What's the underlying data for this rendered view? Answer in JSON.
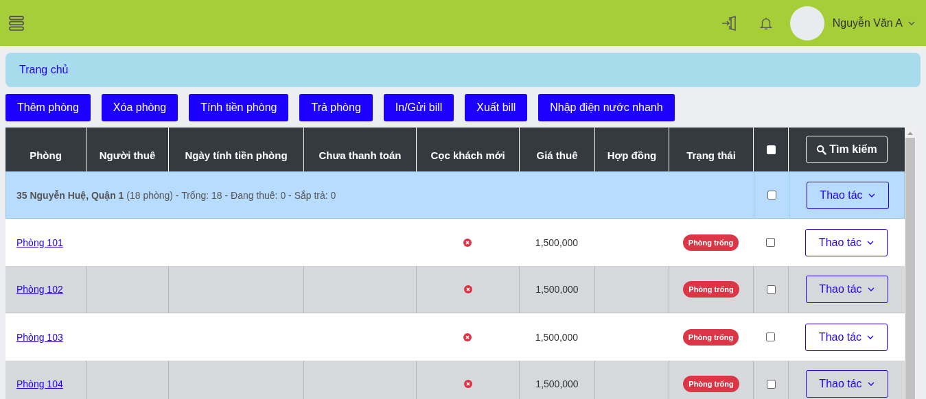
{
  "topbar": {
    "user_name": "Nguyễn Văn A"
  },
  "breadcrumb": "Trang chủ",
  "actions": [
    "Thêm phòng",
    "Xóa phòng",
    "Tính tiền phòng",
    "Trả phòng",
    "In/Gửi bill",
    "Xuất bill",
    "Nhập điện nước nhanh"
  ],
  "table": {
    "columns": [
      "Phòng",
      "Người thuê",
      "Ngày tính tiền phòng",
      "Chưa thanh toán",
      "Cọc khách mới",
      "Giá thuê",
      "Hợp đồng",
      "Trạng thái"
    ],
    "select_all_checked": false,
    "search_button": "Tìm kiếm",
    "group": {
      "summary": "**35 Nguyễn Huệ, Quận 1** (18 phòng) - Trống: 18 - Đang thuê: 0 - Sắp trả: 0",
      "checked": false,
      "action": "Thao tác"
    },
    "rows": [
      {
        "room": "Phòng 101",
        "deposit_paid": false,
        "price": "1,500,000",
        "status": "Phòng trống",
        "checked": false,
        "action": "Thao tác"
      },
      {
        "room": "Phòng 102",
        "deposit_paid": false,
        "price": "1,500,000",
        "status": "Phòng trống",
        "checked": false,
        "action": "Thao tác"
      },
      {
        "room": "Phòng 103",
        "deposit_paid": false,
        "price": "1,500,000",
        "status": "Phòng trống",
        "checked": false,
        "action": "Thao tác"
      },
      {
        "room": "Phòng 104",
        "deposit_paid": false,
        "price": "1,500,000",
        "status": "Phòng trống",
        "checked": false,
        "action": "Thao tác"
      }
    ]
  }
}
